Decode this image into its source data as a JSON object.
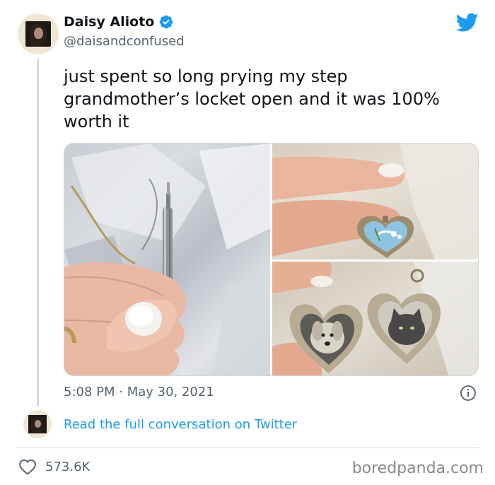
{
  "author": {
    "display_name": "Daisy Alioto",
    "handle": "@daisandconfused",
    "verified": true
  },
  "tweet": {
    "text": "just spent so long prying my step\ngrandmother’s locket open and it was 100%\nworth it",
    "timestamp": "5:08 PM · May 30, 2021"
  },
  "media": [
    {
      "icon": "photo-screwdriver"
    },
    {
      "icon": "photo-locket-closed"
    },
    {
      "icon": "photo-locket-open"
    }
  ],
  "footer": {
    "read_link": "Read the full conversation on Twitter",
    "likes": "573.6K",
    "watermark": "boredpanda.com"
  },
  "colors": {
    "accent": "#1d9bf0",
    "text_secondary": "#536471",
    "divider": "#cfd9de"
  }
}
